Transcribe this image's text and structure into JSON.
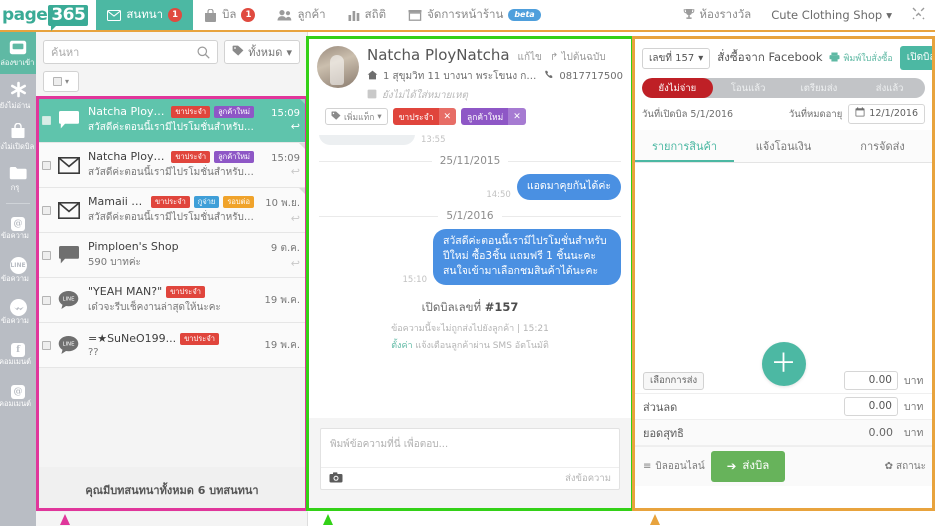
{
  "topnav": {
    "logo_left": "page",
    "logo_right": "365",
    "items": [
      {
        "label": "สนทนา",
        "icon": "envelope-icon",
        "badge": "1",
        "active": true
      },
      {
        "label": "บิล",
        "icon": "bag-icon",
        "badge": "1",
        "active": false
      },
      {
        "label": "ลูกค้า",
        "icon": "people-icon",
        "badge": "",
        "active": false
      },
      {
        "label": "สถิติ",
        "icon": "bar-chart-icon",
        "badge": "",
        "active": false
      },
      {
        "label": "จัดการหน้าร้าน",
        "icon": "storefront-icon",
        "badge": "",
        "beta": "beta",
        "active": false
      }
    ],
    "rewards_label": "ห้องรางวัล",
    "shop_label": "Cute Clothing Shop",
    "collapse_icon": "collapse-icon"
  },
  "rail": {
    "items": [
      {
        "icon": "inbox-icon",
        "label": "กล่องขาเข้า",
        "active": true
      },
      {
        "icon": "asterisk-icon",
        "label": "ยังไม่อ่าน",
        "active": false
      },
      {
        "icon": "bag-icon",
        "label": "ยังไม่เปิดบิล",
        "active": false
      },
      {
        "icon": "folder-icon",
        "label": "กรุ",
        "active": false
      },
      {
        "icon": "instagram-message-icon",
        "label": "ข้อความ",
        "badge": "@",
        "active": false
      },
      {
        "icon": "line-message-icon",
        "label": "ข้อความ",
        "badge": "LINE",
        "active": false
      },
      {
        "icon": "messenger-message-icon",
        "label": "ข้อความ",
        "badge": "m",
        "active": false
      },
      {
        "icon": "facebook-comment-icon",
        "label": "คอมเมนต์",
        "badge": "f",
        "active": false
      },
      {
        "icon": "instagram-comment-icon",
        "label": "คอมเมนต์",
        "badge": "@",
        "active": false
      }
    ]
  },
  "conversations": {
    "search_placeholder": "ค้นหา",
    "tag_filter_label": "ทั้งหมด",
    "tag_filter_icon": "tag-icon",
    "select_all_icon": "checkbox-icon",
    "rows": [
      {
        "name": "Natcha PloyNat...",
        "preview": "สวัสดีค่ะตอนนี้เรามีไปรโมชั่นสำหรับปีใหม่ ซื้อ...",
        "time": "15:09",
        "avatar": "chat-bubble-icon",
        "tags": [
          {
            "label": "ขาประจำ",
            "color": "red"
          },
          {
            "label": "ลูกค้าใหม่",
            "color": "purple"
          }
        ],
        "selected": true
      },
      {
        "name": "Natcha PloyNat...",
        "preview": "สวัสดีค่ะตอนนี้เรามีไปรโมชั่นสำหรับปีใหม่ ซื้อ...",
        "time": "15:09",
        "avatar": "envelope-icon",
        "tags": [
          {
            "label": "ขาประจำ",
            "color": "red"
          },
          {
            "label": "ลูกค้าใหม่",
            "color": "purple"
          }
        ],
        "selected": false
      },
      {
        "name": "Mamaii Dkg",
        "preview": "สวัสดีค่ะตอนนี้เรามีไปรโมชั่นสำหรับปีใหม่ ซื้อ...",
        "time": "10 พ.ย.",
        "avatar": "envelope-icon",
        "tags": [
          {
            "label": "ขาประจำ",
            "color": "red"
          },
          {
            "label": "กูจ่าย",
            "color": "blue"
          },
          {
            "label": "รอบต่อ",
            "color": "orange"
          }
        ],
        "selected": false
      },
      {
        "name": "Pimploen's Shop",
        "preview": "590 บาทค่ะ",
        "time": "9 ต.ค.",
        "avatar": "chat-bubble-icon",
        "tags": [],
        "selected": false
      },
      {
        "name": "\"YEAH MAN?\"",
        "preview": "เด๋วจะรีบเช็คงานล่าสุดให้นะคะ",
        "time": "19 พ.ค.",
        "avatar": "line-icon",
        "tags": [
          {
            "label": "ขาประจำ",
            "color": "red"
          }
        ],
        "selected": false
      },
      {
        "name": "=★SuNeO199...",
        "preview": "??",
        "time": "19 พ.ค.",
        "avatar": "line-icon",
        "tags": [
          {
            "label": "ขาประจำ",
            "color": "red"
          }
        ],
        "selected": false
      }
    ],
    "footer": "คุณมีบทสนทนาทั้งหมด 6 บทสนทนา"
  },
  "chat": {
    "customer_name": "Natcha PloyNatcha",
    "edit_label": "แก้ไข",
    "origin_label": "ไปต้นฉบับ",
    "origin_icon": "external-link-icon",
    "address_icon": "home-icon",
    "address": "1 สุขุมวิท 11 บางนา พระโขนง กทม 10...",
    "phone_icon": "phone-icon",
    "phone": "0817717500",
    "note_icon": "note-icon",
    "note_placeholder": "ยังไม่ได้ใส่หมายเหตุ",
    "add_tag_label": "เพิ่มแท็ก",
    "add_tag_icon": "tag-icon",
    "tags": [
      {
        "label": "ขาประจำ",
        "color": "red"
      },
      {
        "label": "ลูกค้าใหม่",
        "color": "purple"
      }
    ],
    "partial_time": "13:55",
    "threads": [
      {
        "type": "date",
        "value": "25/11/2015"
      },
      {
        "type": "out",
        "text": "แอดมาคุยกันได้ค่ะ",
        "time": "14:50"
      },
      {
        "type": "date",
        "value": "5/1/2016"
      },
      {
        "type": "out",
        "text": "สวัสดีค่ะตอนนี้เรามีไปรโมชั่นสำหรับปีใหม่ ซื้อ3ชิ้น แถมฟรี 1 ชิ้นนะคะ สนใจเข้ามาเลือกชมสินค้าได้นะคะ",
        "time": "15:10"
      }
    ],
    "system_title_pre": "เปิดบิลเลขที่ ",
    "system_title_num": "#157",
    "system_sub": "ข้อความนี้จะไม่ถูกส่งไปยังลูกค้า | 15:21",
    "system_link": "ตั้งค่า",
    "system_sub2": " แจ้งเตือนลูกค้าผ่าน SMS อัตโนมัติ",
    "composer_placeholder": "พิมพ์ข้อความที่นี่ เพื่อตอบ...",
    "camera_icon": "camera-icon",
    "send_label": "ส่งข้อความ"
  },
  "order": {
    "number_label": "เลขที่ 157",
    "source_label": "สั่งซื้อจาก Facebook",
    "print_label": "พิมพ์ใบสั่งซื้อ",
    "print_icon": "printer-icon",
    "new_bill_label": "เปิดบิลใหม่",
    "statuses": [
      {
        "label": "ยังไม่จ่าย",
        "active": true
      },
      {
        "label": "โอนแล้ว",
        "active": false
      },
      {
        "label": "เตรียมส่ง",
        "active": false
      },
      {
        "label": "ส่งแล้ว",
        "active": false
      }
    ],
    "open_date_label": "วันที่เปิดบิล 5/1/2016",
    "expire_label": "วันที่หมดอายุ",
    "expire_date": "12/1/2016",
    "calendar_icon": "calendar-icon",
    "tabs": [
      {
        "label": "รายการสินค้า",
        "active": true
      },
      {
        "label": "แจ้งโอนเงิน",
        "active": false
      },
      {
        "label": "การจัดส่ง",
        "active": false
      }
    ],
    "add_item_icon": "plus-icon",
    "totals": [
      {
        "label": "เลือกการส่ง",
        "is_button": true,
        "value": "0.00",
        "editable": true,
        "unit": "บาท"
      },
      {
        "label": "ส่วนลด",
        "is_button": false,
        "value": "0.00",
        "editable": true,
        "unit": "บาท"
      },
      {
        "label": "ยอดสุทธิ",
        "is_button": false,
        "value": "0.00",
        "editable": false,
        "unit": "บาท"
      }
    ],
    "online_bill_label": "บิลออนไลน์",
    "online_bill_icon": "list-icon",
    "send_bill_label": "ส่งบิล",
    "send_bill_icon": "arrow-right-icon",
    "status_label": "สถานะ",
    "status_icon": "gear-icon"
  },
  "colors": {
    "brand_teal": "#4cb8a3",
    "accent_orange": "#e8a33d",
    "pink_frame": "#e0369b",
    "green_frame": "#33d117",
    "status_red": "#bf2026",
    "bubble_blue": "#4a90e2",
    "send_green": "#67b35b"
  }
}
